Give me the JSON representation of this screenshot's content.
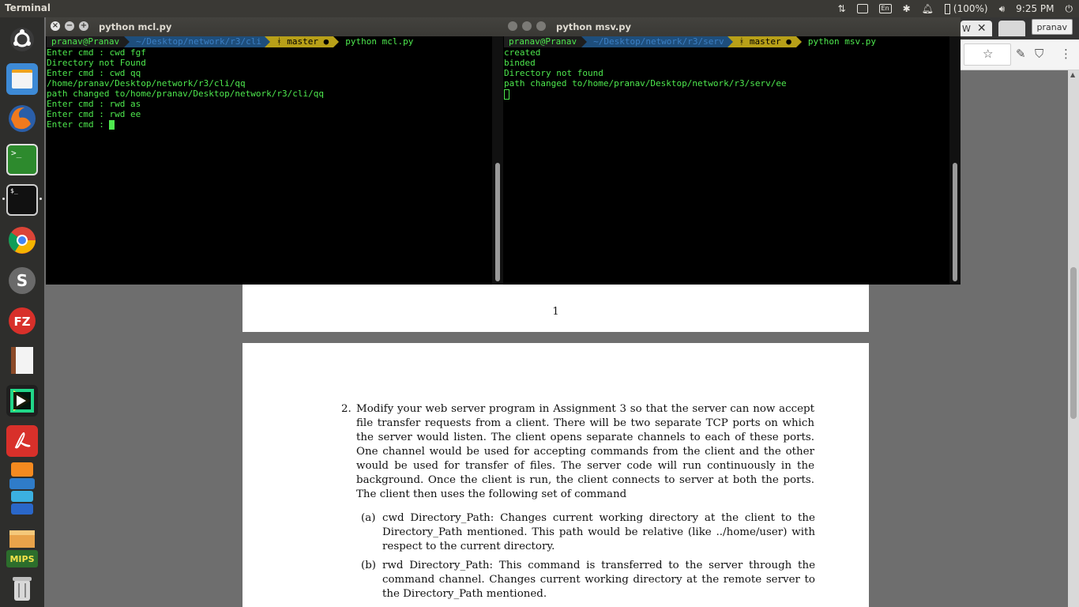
{
  "top_panel": {
    "app_title": "Terminal",
    "battery": "(100%)",
    "time": "9:25 PM",
    "keyboard_layout": "En"
  },
  "launcher": {
    "items": [
      "ubuntu-home",
      "files",
      "firefox",
      "terminal",
      "terminal-2",
      "chrome",
      "sublime",
      "filezilla",
      "cookbook",
      "pycharm",
      "acrobat",
      "misc-1",
      "misc-2",
      "misc-3",
      "mips",
      "trash"
    ],
    "mips_label": "MIPS"
  },
  "browser": {
    "tab_partial": "W",
    "profile": "pranav"
  },
  "terminal_left": {
    "title": "python mcl.py",
    "prompt": {
      "user": "pranav@Pranav",
      "path": "~/Desktop/network/r3/cli",
      "branch": "master",
      "command": "python mcl.py"
    },
    "lines": [
      "Enter cmd : cwd fgf",
      "Directory not Found",
      "Enter cmd : cwd qq",
      "/home/pranav/Desktop/network/r3/cli/qq",
      "path changed to/home/pranav/Desktop/network/r3/cli/qq",
      "Enter cmd : rwd as",
      "Enter cmd : rwd ee",
      "Enter cmd : "
    ]
  },
  "terminal_right": {
    "title": "python msv.py",
    "prompt": {
      "user": "pranav@Pranav",
      "path": "~/Desktop/network/r3/serv",
      "branch": "master",
      "command": "python msv.py"
    },
    "lines": [
      "created",
      "binded",
      "Directory not found",
      "path changed to/home/pranav/Desktop/network/r3/serv/ee"
    ]
  },
  "document": {
    "page1_number": "1",
    "q2_number": "2.",
    "q2_text": "Modify your web server program in Assignment 3 so that the server can now accept file transfer requests from a client. There will be two separate TCP ports on which the server would listen. The client opens separate channels to each of these ports. One channel would be used for accepting commands from the client and the other would be used for transfer of files. The server code will run continuously in the background. Once the client is run, the client connects to server at both the ports. The client then uses the following set of command",
    "sub_a_label": "(a)",
    "sub_a_text": "cwd Directory_Path: Changes current working directory at the client to the Directory_Path mentioned. This path would be relative (like ../home/user) with respect to the current directory.",
    "sub_b_label": "(b)",
    "sub_b_text": "rwd Directory_Path: This command is transferred to the server through the command channel. Changes current working directory at the remote server to the Directory_Path mentioned."
  }
}
